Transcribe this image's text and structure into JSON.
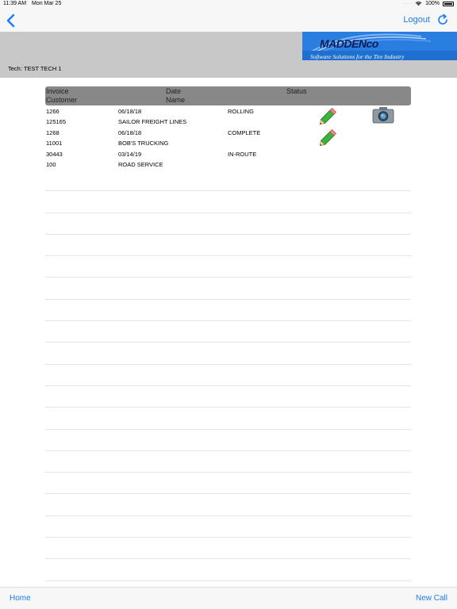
{
  "status_bar": {
    "time": "11:39 AM",
    "date": "Mon Mar 25",
    "battery": "100%"
  },
  "nav": {
    "logout_label": "Logout"
  },
  "header": {
    "logo_text": "MADDENco",
    "logo_subtitle": "Software Solutions for the Tire Industry",
    "tech_label": "Tech: TEST TECH 1"
  },
  "table": {
    "headers": {
      "invoice": "Invoice",
      "customer": "Customer",
      "date": "Date",
      "name": "Name",
      "status": "Status"
    },
    "rows": [
      {
        "invoice": "1266",
        "customer": "125165",
        "date": "06/18/18",
        "name": "SAILOR FREIGHT LINES",
        "status": "ROLLING",
        "edit_icon": "pencil-icon",
        "camera_icon": "camera-icon"
      },
      {
        "invoice": "1268",
        "customer": "11001",
        "date": "06/18/18",
        "name": "BOB'S TRUCKING",
        "status": "COMPLETE",
        "edit_icon": "pencil-icon"
      },
      {
        "invoice": "30443",
        "customer": "100",
        "date": "03/14/19",
        "name": "ROAD SERVICE",
        "status": "IN-ROUTE"
      }
    ]
  },
  "bottom": {
    "home_label": "Home",
    "new_call_label": "New Call"
  },
  "colors": {
    "accent": "#1a7cf5",
    "header_band": "#c8c8c8",
    "table_header": "#888888",
    "logo_bg": "#1e6fd0"
  }
}
